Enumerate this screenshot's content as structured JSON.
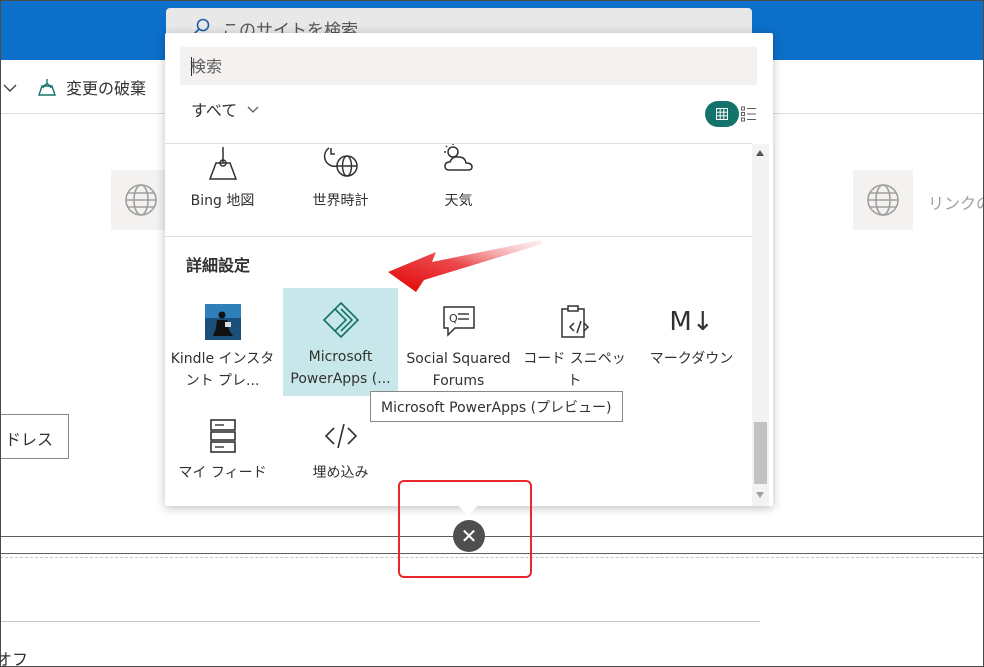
{
  "suite": {
    "site_search_placeholder": "このサイトを検索"
  },
  "command_bar": {
    "discard_label": "変更の破棄"
  },
  "background": {
    "link_text": "リンクの",
    "address_button": "ドレス",
    "bottom_text": "オフ"
  },
  "picker": {
    "search_placeholder": "検索",
    "filter_label": "すべて",
    "top_tiles": [
      {
        "label": "Bing 地図",
        "icon": "map-pin-icon"
      },
      {
        "label": "世界時計",
        "icon": "world-clock-icon"
      },
      {
        "label": "天気",
        "icon": "weather-icon"
      }
    ],
    "section_title": "詳細設定",
    "advanced_tiles": [
      {
        "label": "Kindle インスタント プレ...",
        "icon": "kindle-icon"
      },
      {
        "label": "Microsoft PowerApps (...",
        "icon": "powerapps-icon",
        "selected": true
      },
      {
        "label": "Social Squared Forums",
        "icon": "forums-icon"
      },
      {
        "label": "コード スニペット",
        "icon": "code-snippet-icon"
      },
      {
        "label": "マークダウン",
        "icon": "markdown-icon"
      },
      {
        "label": "マイ フィード",
        "icon": "my-feed-icon"
      },
      {
        "label": "埋め込み",
        "icon": "embed-icon"
      }
    ],
    "tooltip": "Microsoft PowerApps (プレビュー)",
    "markdown_glyph": "M↓"
  },
  "colors": {
    "suite_bar": "#0c6fc9",
    "accent": "#13736b",
    "selected_tile": "#c7e7ea",
    "annotation_red": "#e8282c"
  }
}
